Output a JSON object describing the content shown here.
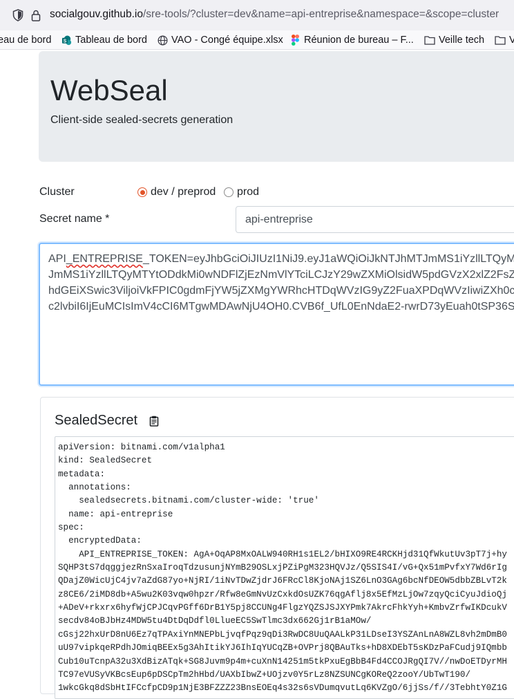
{
  "browser": {
    "url_host": "socialgouv.github.io",
    "url_path": "/sre-tools/?cluster=dev&name=api-entreprise&namespace=&scope=cluster",
    "bookmarks": [
      {
        "label": "eau de bord",
        "icon": "none"
      },
      {
        "label": "Tableau de bord",
        "icon": "sharepoint-icon"
      },
      {
        "label": "VAO - Congé équipe.xlsx",
        "icon": "globe-icon"
      },
      {
        "label": "Réunion de bureau – F...",
        "icon": "figma-icon"
      },
      {
        "label": "Veille tech",
        "icon": "folder-icon"
      },
      {
        "label": "V",
        "icon": "folder-icon"
      }
    ]
  },
  "header": {
    "title": "WebSeal",
    "subtitle": "Client-side sealed-secrets generation"
  },
  "form": {
    "cluster_label": "Cluster",
    "cluster_options": [
      {
        "label": "dev / preprod",
        "checked": true
      },
      {
        "label": "prod",
        "checked": false
      }
    ],
    "secret_name_label": "Secret name *",
    "secret_name_value": "api-entreprise",
    "secret_value_lines": [
      {
        "pre": "API",
        "spell": "_ENTREPRISE",
        "post": "_TOKEN=eyJhbGciOiJIUzI1NiJ9.eyJ1aWQiOiJkNTJhMTJmMS1iYzllLTQyM"
      },
      {
        "pre": "JmMS1iYzllLTQyMTYtODdkMi0wNDFlZjEzNmVlYTciLCJzY29wZXMiOlsidW5pdGVzX2xlZ2FsZ",
        "spell": "",
        "post": ""
      },
      {
        "pre": "hdGEiXSwic3ViljoiVkFPIC0gdmFjYW5jZXMgYWRhcHTDqWVzIG9yZ2FuaXPDqWVzIiwiZXh0c",
        "spell": "",
        "post": ""
      },
      {
        "pre": "c2lvbiI6IjEuMCIsImV4cCI6MTgwMDAwNjU4OH0.CVB6f_UfL0EnNdaE2-rwrD73yEuah0tSP36S",
        "spell": "",
        "post": ""
      }
    ]
  },
  "sealed": {
    "title": "SealedSecret",
    "copy_icon": "clipboard-icon",
    "yaml_lines": [
      "apiVersion: bitnami.com/v1alpha1",
      "kind: SealedSecret",
      "metadata:",
      "  annotations:",
      "    sealedsecrets.bitnami.com/cluster-wide: 'true'",
      "  name: api-entreprise",
      "spec:",
      "  encryptedData:",
      "    API_ENTREPRISE_TOKEN: AgA+OqAP8MxOALW940RH1s1EL2/bHIXO9RE4RCKHjd31QfWkutUv3pT7j+hy",
      "SQHP3tS7dqggjezRnSxaIroqTdzusunjNYmB29OSLxjPZiPgM323HQVJz/Q5SIS4I/vG+Qx51mPvfxY7Wd6rIg",
      "QDajZ0WicUjC4jv7aZdG87yo+NjRI/1iNvTDwZjdrJ6FRcCl8KjoNAj1SZ6LnO3GAg6bcNfDEOW5dbbZBLvT2k",
      "z8CE6/2iMD8db+A5wu2K03vqw0hpzr/Rfw8eGmNvUzCxkdOsUZK76qgAflj8x5EfMzLjOw7zqyQciCyuJdioQj",
      "+ADeV+rkxrx6hyfWjCPJCqvPGff6DrB1Y5pj8CCUNg4FlgzYQZSJSJXYPmk7AkrcFhkYyh+KmbvZrfwIKDcukV",
      "secdv84oBJbHz4MDW5tu4DtDqDdfl0LlueEC5SwTlmc3dx662Gj1rB1aMOw/",
      "cGsj22hxUrD8nU6Ez7qTPAxiYnMNEPbLjvqfPqz9qDi3RwDC8UuQAALkP31LDseI3YSZAnLnA8WZL8vh2mDmB0",
      "uU97vipkqeRPdhJOmiqBEEx5g3AhItikYJ6IhIqYUCqZB+OVPrj8QBAuTks+hD8XDEbT5sKDzPaFCudj9IQmbb",
      "Cub10uTcnpA32u3XdBizATqk+SG8Juvm9p4m+cuXnN14251m5tkPxuEgBbB4Fd4CCOJRgQI7V//nwDoETDyrMH",
      "TC97eVUSyVKBcsEup6pDSCpTm2hHbd/UAXbIbwZ+UOjzv0Y5rLz8NZSUNCgKOReQ2zooY/UbTwT190/",
      "1wkcGkq8dSbHtIFCcfpCD9p1NjE3BFZZZ23BnsEOEq4s32s6sVDumqvutLq6KVZgO/6jjSs/f//3TebhtY0Z1G"
    ]
  },
  "colors": {
    "radio_accent": "#e2552a",
    "focus_border": "#80bdff",
    "jumbotron_bg": "#e9ecef"
  }
}
